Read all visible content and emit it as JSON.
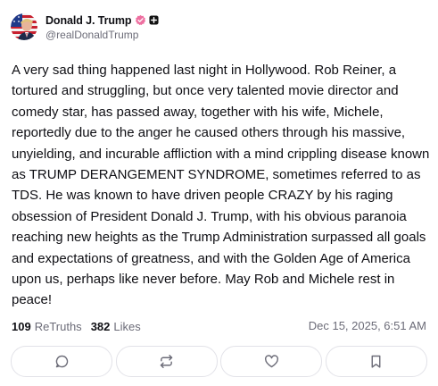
{
  "author": {
    "display_name": "Donald J. Trump",
    "handle": "@realDonaldTrump",
    "avatar_icon": "avatar-flag-portrait",
    "verified_icon": "verified-badge-icon",
    "verified_color": "#ee6fa0",
    "plus_icon": "plus-badge-icon"
  },
  "post": {
    "text": "A very sad thing happened last night in Hollywood. Rob Reiner, a tortured and struggling, but once very talented movie director and comedy star, has passed away, together with his wife, Michele, reportedly due to the anger he caused others through his massive, unyielding, and incurable affliction with a mind crippling disease known as TRUMP DERANGEMENT SYNDROME, sometimes referred to as TDS. He was known to have driven people CRAZY by his raging obsession of President Donald J. Trump, with his obvious paranoia reaching new heights as the Trump Administration surpassed all goals and expectations of greatness, and with the Golden Age of America upon us, perhaps like never before. May Rob and Michele rest in peace!",
    "retruths_count": "109",
    "retruths_label": "ReTruths",
    "likes_count": "382",
    "likes_label": "Likes",
    "timestamp": "Dec 15, 2025, 6:51 AM"
  },
  "actions": [
    {
      "name": "reply",
      "icon": "comment-icon"
    },
    {
      "name": "retruth",
      "icon": "repost-icon"
    },
    {
      "name": "like",
      "icon": "heart-icon"
    },
    {
      "name": "bookmark",
      "icon": "bookmark-icon"
    }
  ],
  "colors": {
    "text_primary": "#0f0f14",
    "text_secondary": "#6c6c78",
    "button_border": "#e2e2e8",
    "icon": "#6c6c78"
  }
}
